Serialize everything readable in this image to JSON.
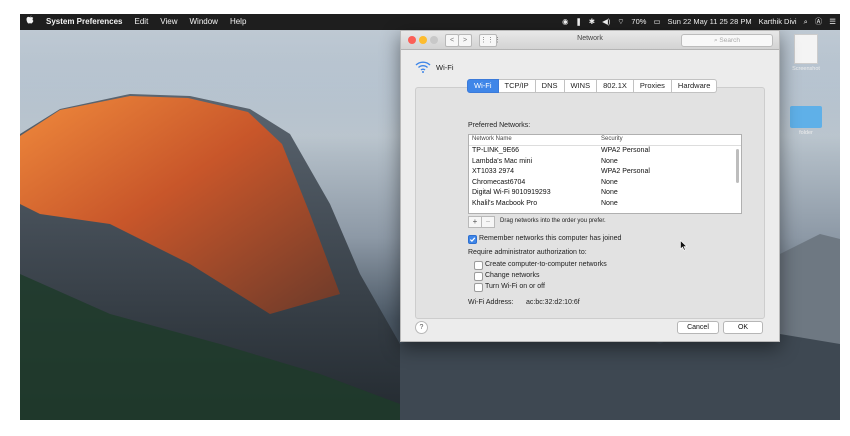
{
  "menubar": {
    "apple": "",
    "app": "System Preferences",
    "items": [
      "Edit",
      "View",
      "Window",
      "Help"
    ],
    "battery": "70%",
    "datetime": "Sun 22 May  11 25 28 PM",
    "user": "Karthik Divi"
  },
  "desktop": {
    "icon1_label": "Screenshot",
    "icon2_label": "folder"
  },
  "window": {
    "title": "Network",
    "search_placeholder": "Search",
    "nav_back": "<",
    "nav_forward": ">",
    "grid": "⋮⋮⋮",
    "section": "Wi-Fi",
    "tabs": [
      "Wi-Fi",
      "TCP/IP",
      "DNS",
      "WINS",
      "802.1X",
      "Proxies",
      "Hardware"
    ],
    "preferred_label": "Preferred Networks:",
    "col_name": "Network Name",
    "col_security": "Security",
    "networks": [
      {
        "name": "TP-LINK_9E66",
        "security": "WPA2 Personal"
      },
      {
        "name": "Lambda's Mac mini",
        "security": "None"
      },
      {
        "name": "XT1033 2974",
        "security": "WPA2 Personal"
      },
      {
        "name": "Chromecast6704",
        "security": "None"
      },
      {
        "name": "Digital Wi-Fi 9010919293",
        "security": "None"
      },
      {
        "name": "Khalil's Macbook Pro",
        "security": "None"
      }
    ],
    "plus": "+",
    "minus": "−",
    "drag_hint": "Drag networks into the order you prefer.",
    "remember_label": "Remember networks this computer has joined",
    "admin_label": "Require administrator authorization to:",
    "admin_options": [
      "Create computer-to-computer networks",
      "Change networks",
      "Turn Wi-Fi on or off"
    ],
    "wifi_address_label": "Wi-Fi Address:",
    "wifi_address": "ac:bc:32:d2:10:6f",
    "help": "?",
    "cancel": "Cancel",
    "ok": "OK"
  }
}
